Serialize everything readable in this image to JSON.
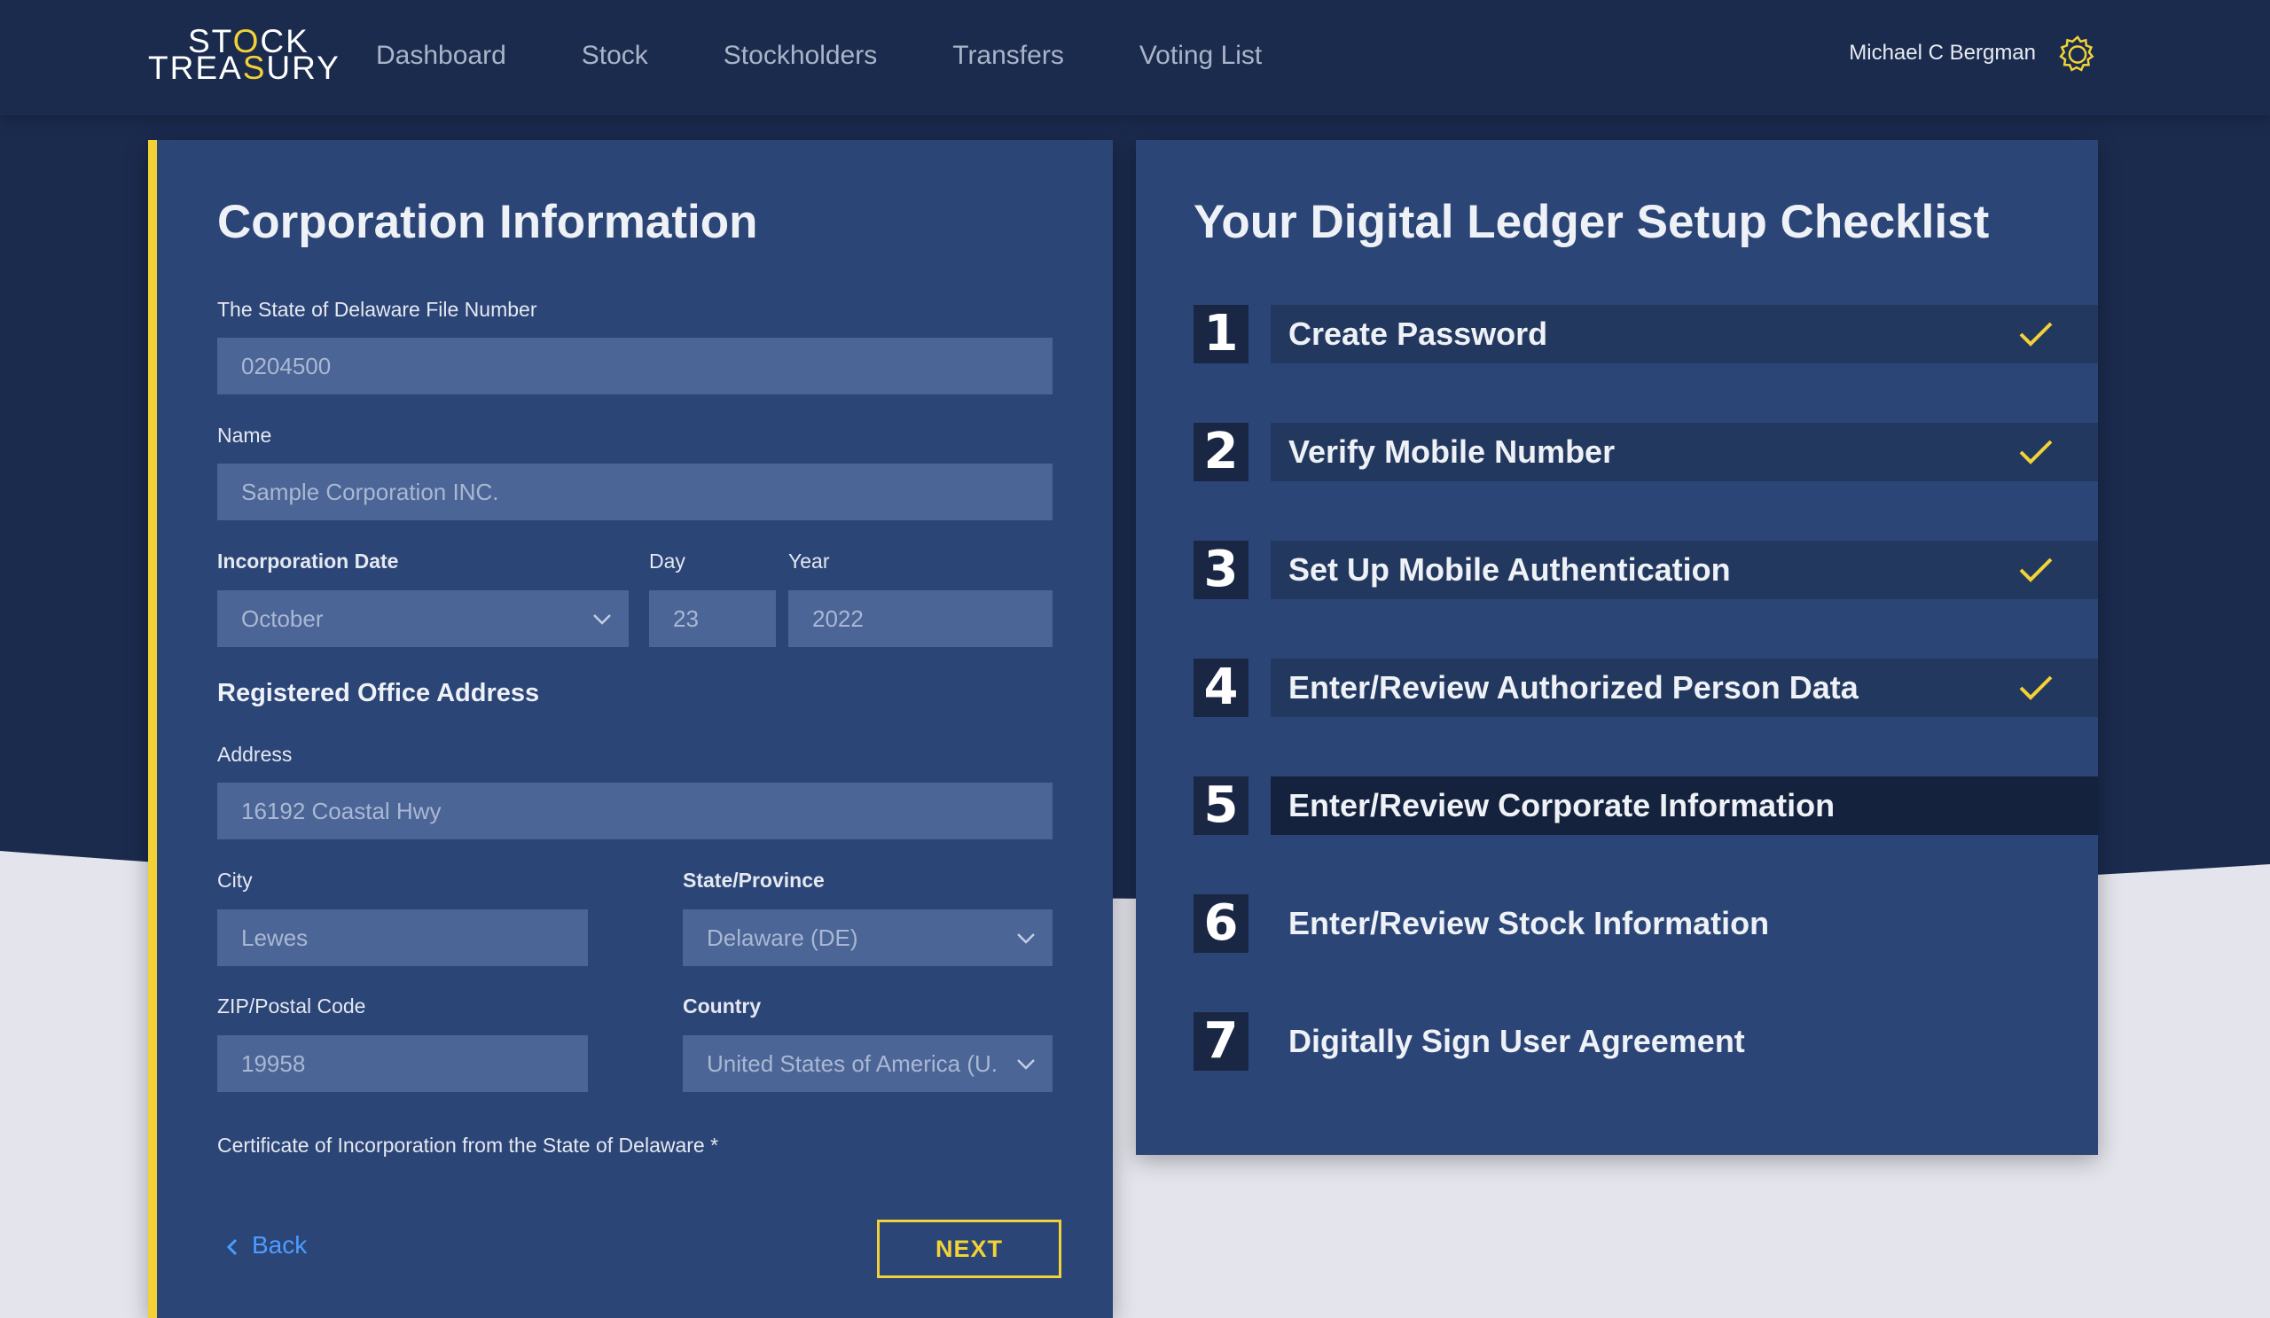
{
  "brand": {
    "logo_top": "STOCK",
    "logo_bottom": "TREASURY",
    "accent_color": "#f2d236"
  },
  "nav": {
    "links": [
      "Dashboard",
      "Stock",
      "Stockholders",
      "Transfers",
      "Voting List"
    ],
    "user_name": "Michael C Bergman",
    "settings_icon": "gear-icon"
  },
  "corporation": {
    "title": "Corporation Information",
    "file_number": {
      "label": "The State of Delaware File Number",
      "value": "0204500"
    },
    "name": {
      "label": "Name",
      "value": "Sample Corporation INC."
    },
    "incorporation_date": {
      "label": "Incorporation Date",
      "month": "October",
      "day_label": "Day",
      "day": "23",
      "year_label": "Year",
      "year": "2022"
    },
    "address_section": "Registered Office Address",
    "address": {
      "label": "Address",
      "value": "16192 Coastal Hwy"
    },
    "city": {
      "label": "City",
      "value": "Lewes"
    },
    "state": {
      "label": "State/Province",
      "value": "Delaware (DE)"
    },
    "zip": {
      "label": "ZIP/Postal Code",
      "value": "19958"
    },
    "country": {
      "label": "Country",
      "value": "United States of America (U."
    },
    "certificate_label": "Certificate of Incorporation from the State of Delaware *",
    "back_label": "Back",
    "next_label": "NEXT"
  },
  "checklist": {
    "title": "Your Digital Ledger Setup Checklist",
    "steps": [
      {
        "number": "1",
        "label": "Create Password",
        "done": true,
        "active": false
      },
      {
        "number": "2",
        "label": "Verify Mobile Number",
        "done": true,
        "active": false
      },
      {
        "number": "3",
        "label": "Set Up Mobile Authentication",
        "done": true,
        "active": false
      },
      {
        "number": "4",
        "label": "Enter/Review Authorized Person Data",
        "done": true,
        "active": false
      },
      {
        "number": "5",
        "label": "Enter/Review Corporate Information",
        "done": false,
        "active": true
      },
      {
        "number": "6",
        "label": "Enter/Review Stock Information",
        "done": false,
        "active": false
      },
      {
        "number": "7",
        "label": "Digitally Sign User Agreement",
        "done": false,
        "active": false
      }
    ]
  }
}
